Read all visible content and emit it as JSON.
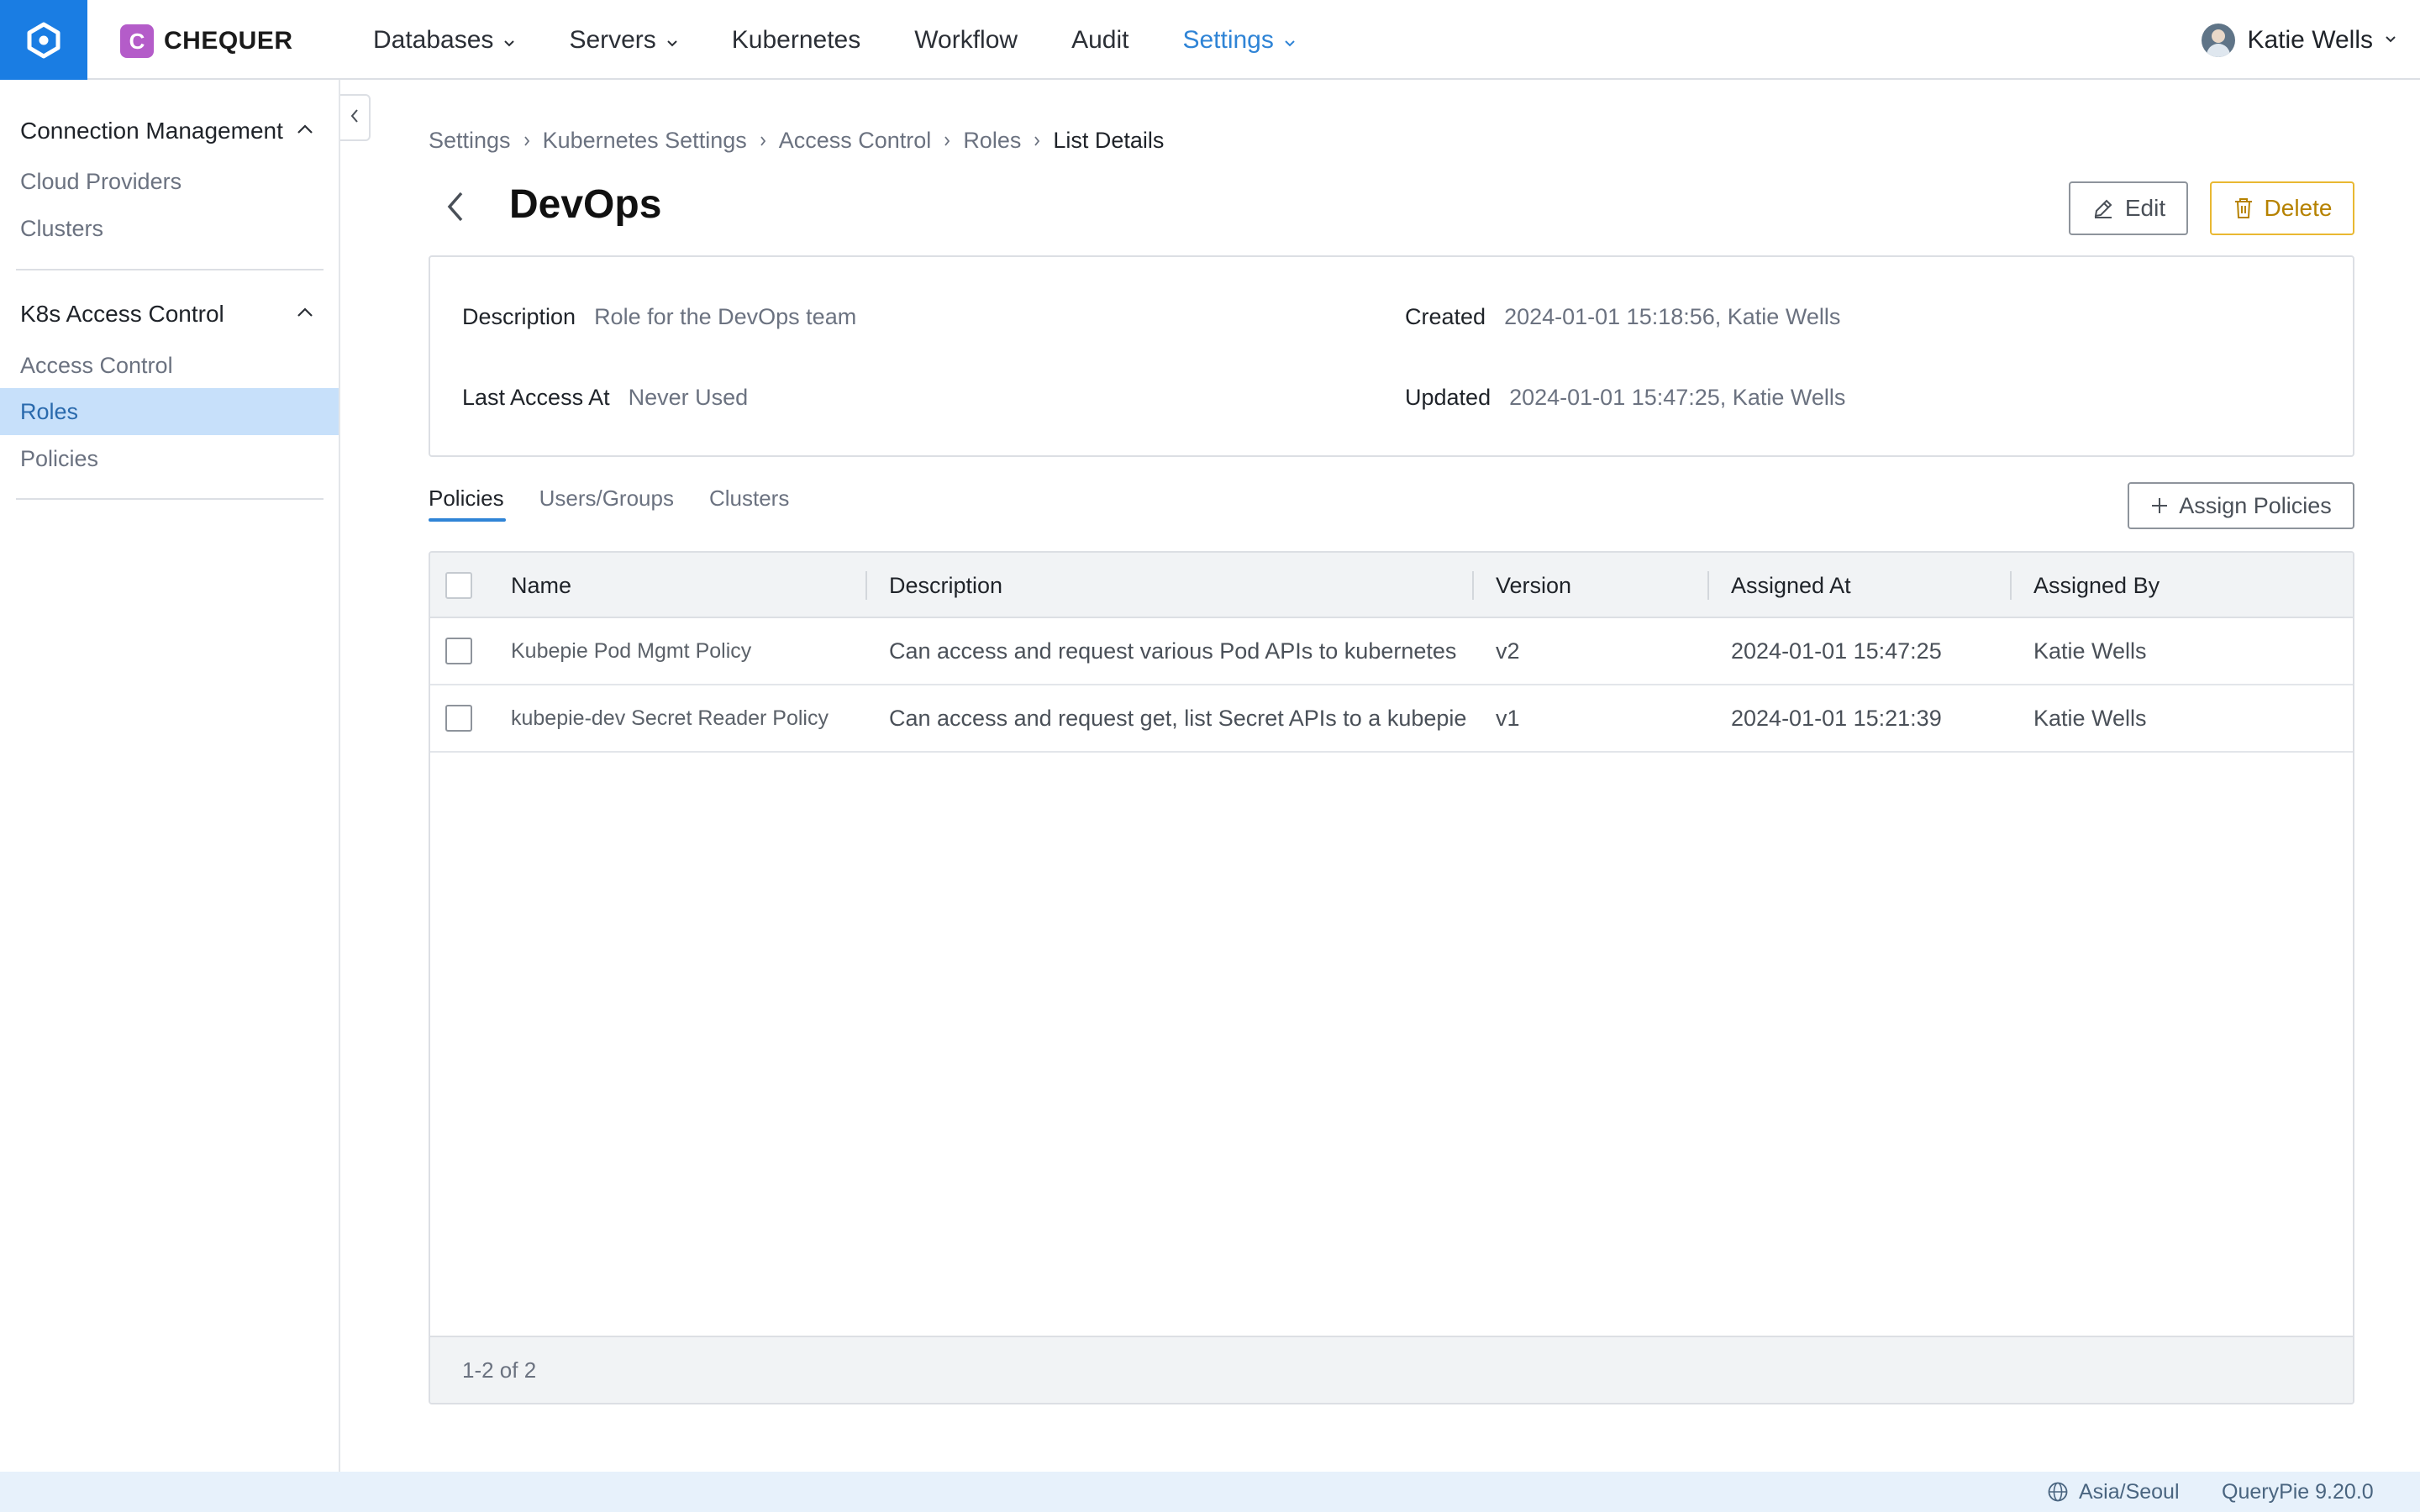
{
  "brand": {
    "letter": "C",
    "name": "CHEQUER"
  },
  "nav": {
    "items": [
      {
        "label": "Databases",
        "has_menu": true
      },
      {
        "label": "Servers",
        "has_menu": true
      },
      {
        "label": "Kubernetes",
        "has_menu": false
      },
      {
        "label": "Workflow",
        "has_menu": false
      },
      {
        "label": "Audit",
        "has_menu": false
      },
      {
        "label": "Settings",
        "has_menu": true,
        "active": true
      }
    ],
    "active_color": "#2f84d6"
  },
  "user": {
    "name": "Katie Wells"
  },
  "sidebar": {
    "groups": [
      {
        "title": "Connection Management",
        "items": [
          "Cloud Providers",
          "Clusters"
        ]
      },
      {
        "title": "K8s Access Control",
        "items": [
          "Access Control",
          "Roles",
          "Policies"
        ]
      }
    ],
    "active_item": "Roles"
  },
  "breadcrumb": [
    "Settings",
    "Kubernetes Settings",
    "Access Control",
    "Roles",
    "List Details"
  ],
  "page": {
    "title": "DevOps",
    "edit_label": "Edit",
    "delete_label": "Delete"
  },
  "info": {
    "description_label": "Description",
    "description_value": "Role for the DevOps team",
    "last_access_label": "Last Access At",
    "last_access_value": "Never Used",
    "created_label": "Created",
    "created_value": "2024-01-01 15:18:56, Katie Wells",
    "updated_label": "Updated",
    "updated_value": "2024-01-01 15:47:25, Katie Wells"
  },
  "tabs": {
    "items": [
      "Policies",
      "Users/Groups",
      "Clusters"
    ],
    "active": "Policies"
  },
  "assign_label": "Assign Policies",
  "table": {
    "columns": [
      "Name",
      "Description",
      "Version",
      "Assigned At",
      "Assigned By"
    ],
    "rows": [
      [
        "Kubepie Pod Mgmt Policy",
        "Can access and request various Pod APIs to kubernetes",
        "v2",
        "2024-01-01 15:47:25",
        "Katie Wells"
      ],
      [
        "kubepie-dev Secret Reader Policy",
        "Can access and request get, list Secret APIs to a kubepie",
        "v1",
        "2024-01-01 15:21:39",
        "Katie Wells"
      ]
    ],
    "footer": "1-2 of 2"
  },
  "status": {
    "timezone": "Asia/Seoul",
    "version": "QueryPie 9.20.0"
  },
  "icons": [
    "app-logo-icon",
    "chevron-down-icon",
    "chevron-up-icon",
    "chevron-left-icon",
    "chevron-right-icon",
    "pencil-icon",
    "trash-icon",
    "plus-icon",
    "globe-icon"
  ]
}
